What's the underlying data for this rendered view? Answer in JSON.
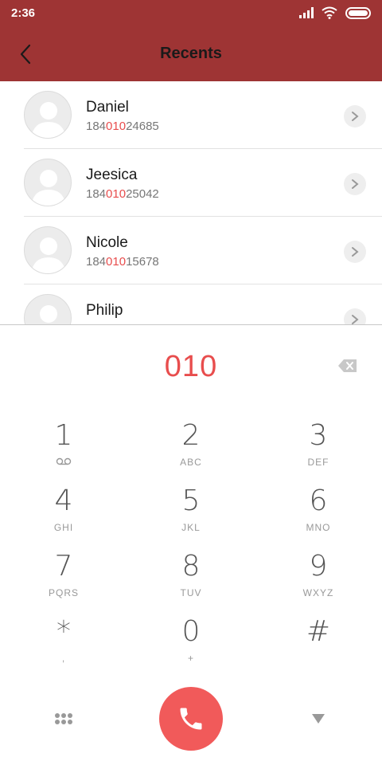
{
  "status_bar": {
    "time": "2:36",
    "icons": [
      "signal-icon",
      "wifi-icon",
      "battery-icon"
    ]
  },
  "app_bar": {
    "title": "Recents",
    "back_icon": "chevron-left-icon",
    "background": "#9e3434"
  },
  "recents": [
    {
      "name": "Daniel",
      "number_prefix": "184",
      "number_match": "010",
      "number_suffix": "24685"
    },
    {
      "name": "Jeesica",
      "number_prefix": "184",
      "number_match": "010",
      "number_suffix": "25042"
    },
    {
      "name": "Nicole",
      "number_prefix": "184",
      "number_match": "010",
      "number_suffix": "15678"
    },
    {
      "name": "Philip",
      "number_prefix": "",
      "number_match": "",
      "number_suffix": ""
    }
  ],
  "dialer": {
    "input": "010",
    "highlight_color": "#e84d4d",
    "keys": [
      {
        "digit": "1",
        "letters": ""
      },
      {
        "digit": "2",
        "letters": "ABC"
      },
      {
        "digit": "3",
        "letters": "DEF"
      },
      {
        "digit": "4",
        "letters": "GHI"
      },
      {
        "digit": "5",
        "letters": "JKL"
      },
      {
        "digit": "6",
        "letters": "MNO"
      },
      {
        "digit": "7",
        "letters": "PQRS"
      },
      {
        "digit": "8",
        "letters": "TUV"
      },
      {
        "digit": "9",
        "letters": "WXYZ"
      },
      {
        "digit": "*",
        "letters": ","
      },
      {
        "digit": "0",
        "letters": "+"
      },
      {
        "digit": "#",
        "letters": ""
      }
    ],
    "call_color": "#f15a5a"
  }
}
